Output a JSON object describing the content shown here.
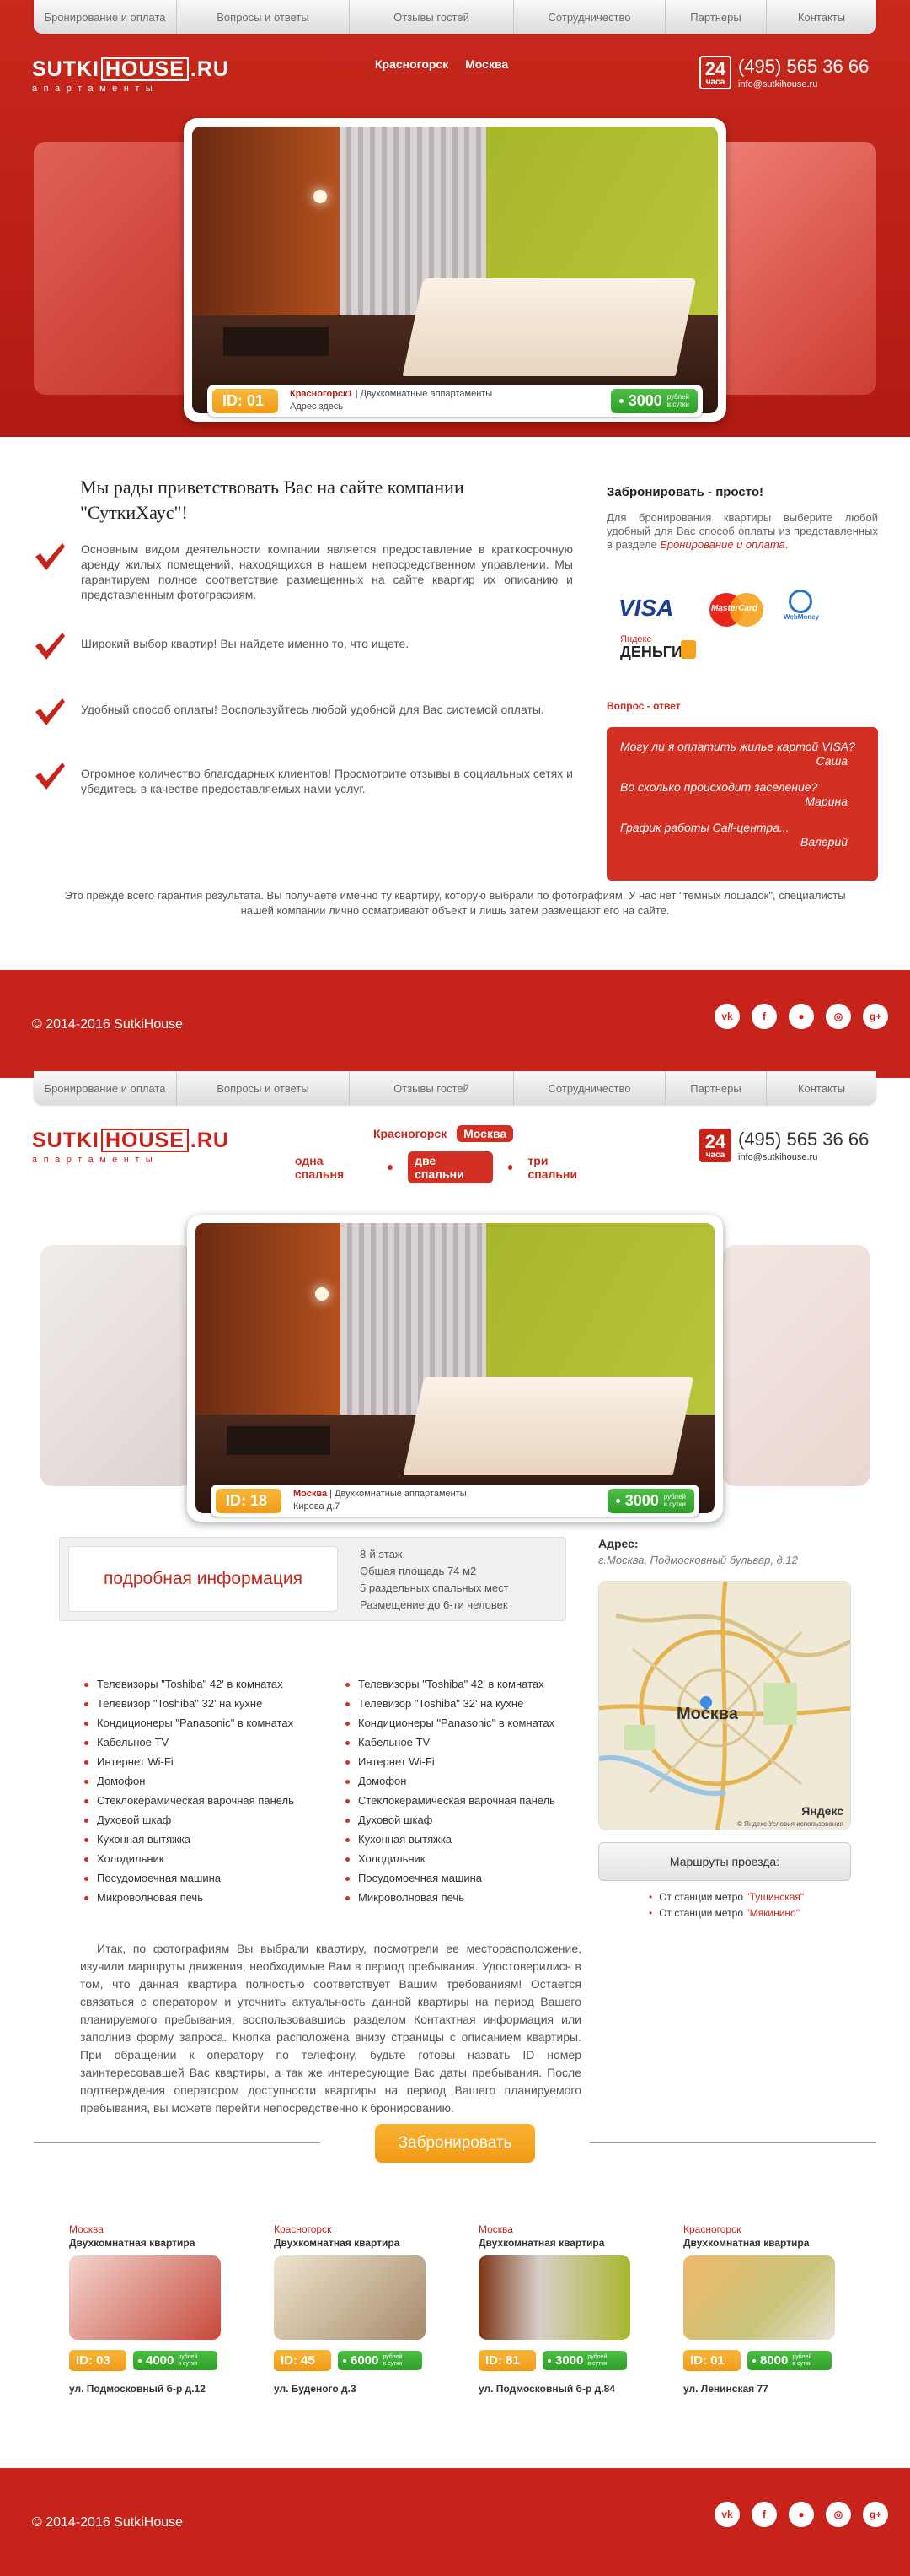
{
  "nav": [
    "Бронирование и оплата",
    "Вопросы и ответы",
    "Отзывы гостей",
    "Сотрудничество",
    "Партнеры",
    "Контакты"
  ],
  "logo": {
    "left": "SUTKI",
    "box": "HOUSE",
    "right": ".RU",
    "tagline": "апартаменты"
  },
  "header": {
    "city1": "Красногорск",
    "city2": "Москва",
    "phone": "(495) 565 36 66",
    "email": "info@sutkihouse.ru",
    "badge_num": "24",
    "badge_text": "часа"
  },
  "hero1": {
    "id": "ID: 01",
    "place": "Красногорск1",
    "type": "Двухкомнатные аппартаменты",
    "address": "Адрес здесь",
    "price": "3000",
    "price_unit1": "рублей",
    "price_unit2": "в сутки"
  },
  "welcome": {
    "title": "Мы рады приветствовать Вас на сайте компании \"СуткиХаус\"!",
    "features": [
      "Основным видом деятельности компании является предоставление в краткосрочную аренду жилых помещений, находящихся в нашем непосредственном управлении. Мы гарантируем полное соответствие размещенных на сайте квартир их описанию и представленным фотографиям.",
      "Широкий выбор квартир! Вы найдете именно то, что ищете.",
      "Удобный способ оплаты! Воспользуйтесь любой удобной для Вас системой оплаты.",
      "Огромное количество благодарных клиентов! Просмотрите отзывы в социальных сетях и убедитесь в качестве предоставляемых нами услуг."
    ],
    "guarantee": "Это прежде всего гарантия результата. Вы получаете именно ту квартиру, которую выбрали по фотографиям. У нас нет \"темных лошадок\", специалисты нашей компании лично осматривают объект и лишь затем размещают его на сайте."
  },
  "booking": {
    "title": "Забронировать - просто!",
    "text": "Для бронирования квартиры выберите любой удобный для Вас способ оплаты из представленных в разделе",
    "link": "Бронирование и оплата",
    "pay": {
      "visa": "VISA",
      "mastercard": "MasterCard",
      "webmoney": "WebMoney",
      "yandex1": "Яндекс",
      "yandex2": "ДЕНЬГИ"
    }
  },
  "qa": {
    "title": "Вопрос - ответ",
    "items": [
      {
        "q": "Могу ли я оплатить жилье картой VISA?",
        "a": "Саша"
      },
      {
        "q": "Во сколько происходит заселение?",
        "a": "Марина"
      },
      {
        "q": "График работы Call-центра...",
        "a": "Валерий"
      }
    ]
  },
  "footer": {
    "copy": "© 2014-2016 SutkiHouse",
    "socials": [
      "vk",
      "f",
      "●",
      "◎",
      "g+"
    ]
  },
  "apt": {
    "sizes": [
      "одна спальня",
      "две спальни",
      "три спальни"
    ],
    "id": "ID: 18",
    "place": "Москва",
    "type": "Двухкомнатные аппартаменты",
    "address": "Кирова д.7",
    "price": "3000",
    "price_unit1": "рублей",
    "price_unit2": "в сутки",
    "detail_btn": "подробная информация",
    "details": [
      "8-й этаж",
      "Общая площадь 74 м2",
      "5 раздельных спальных мест",
      "Размещение до 6-ти человек"
    ],
    "amenities_left": [
      "Телевизоры \"Toshiba\" 42' в комнатах",
      "Телевизор \"Toshiba\" 32' на кухне",
      "Кондиционеры \"Panasonic\" в комнатах",
      "Кабельное TV",
      "Интернет Wi-Fi",
      "Домофон",
      "Стеклокерамическая варочная панель",
      "Духовой шкаф",
      "Кухонная вытяжка",
      "Холодильник",
      "Посудомоечная машина",
      "Микроволновая печь"
    ],
    "amenities_right": [
      "Телевизоры \"Toshiba\" 42' в комнатах",
      "Телевизор \"Toshiba\" 32' на кухне",
      "Кондиционеры \"Panasonic\" в комнатах",
      "Кабельное TV",
      "Интернет Wi-Fi",
      "Домофон",
      "Стеклокерамическая варочная панель",
      "Духовой шкаф",
      "Кухонная вытяжка",
      "Холодильник",
      "Посудомоечная машина",
      "Микроволновая печь"
    ],
    "addr_title": "Адрес:",
    "addr_value": "г.Москва, Подмосковный бульвар, д.12",
    "map_city": "Москва",
    "map_brand": "Яндекс",
    "map_copy": "© Яндекс  Условия использования",
    "routes_btn": "Маршруты проезда:",
    "metro": [
      {
        "pre": "От станции метро ",
        "name": "\"Тушинская\""
      },
      {
        "pre": "От станции метро ",
        "name": "\"Мякинино\""
      }
    ],
    "description": "Итак, по фотографиям Вы выбрали квартиру, посмотрели ее месторасположение, изучили маршруты движения, необходимые Вам в период пребывания. Удостоверились в том, что данная квартира полностью соответствует Вашим требованиям! Остается связаться с оператором и уточнить актуальность данной квартиры на период Вашего планируемого пребывания, воспользовавшись разделом Контактная информация или заполнив форму запроса. Кнопка расположена внизу страницы с описанием квартиры. При обращении к оператору по телефону, будьте готовы назвать ID номер заинтересовавшей Вас квартиры, а так же интересующие Вас даты пребывания. После подтверждения оператором доступности квартиры на период Вашего планируемого пребывания, вы можете перейти непосредственно к бронированию.",
    "book_btn": "Забронировать"
  },
  "cards": [
    {
      "city": "Москва",
      "title": "Двухкомнатная квартира",
      "id": "ID: 03",
      "price": "4000",
      "u1": "рублей",
      "u2": "в сутки",
      "addr": "ул. Подмосковный б-р д.12"
    },
    {
      "city": "Красногорск",
      "title": "Двухкомнатная квартира",
      "id": "ID: 45",
      "price": "6000",
      "u1": "рублей",
      "u2": "в сутки",
      "addr": "ул. Буденого д.3"
    },
    {
      "city": "Москва",
      "title": "Двухкомнатная квартира",
      "id": "ID: 81",
      "price": "3000",
      "u1": "рублей",
      "u2": "в сутки",
      "addr": "ул. Подмосковный б-р д.84"
    },
    {
      "city": "Красногорск",
      "title": "Двухкомнатная квартира",
      "id": "ID: 01",
      "price": "8000",
      "u1": "рублей",
      "u2": "в сутки",
      "addr": "ул. Ленинская 77"
    }
  ],
  "colors": {
    "brand_red": "#c8231a",
    "accent_orange": "#f5a623",
    "price_green": "#3aaf32"
  }
}
